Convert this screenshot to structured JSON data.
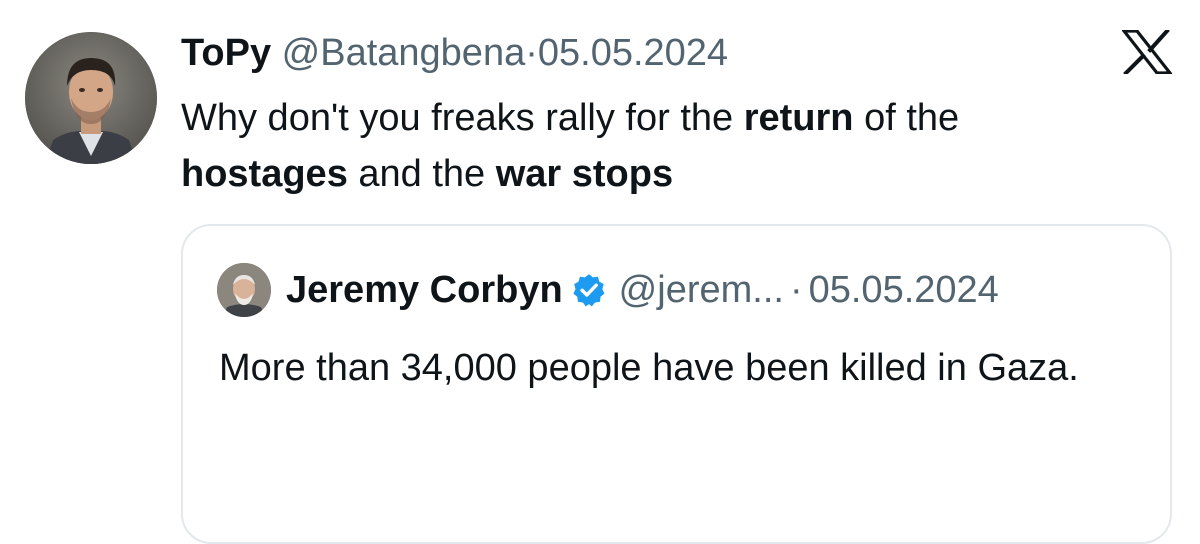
{
  "tweet": {
    "display_name": "ToPy",
    "handle": "@Batangbena",
    "separator": "·",
    "date": "05.05.2024",
    "text_parts": [
      "Why don't you freaks rally for the ",
      "return",
      " of the ",
      "hostages",
      " and the ",
      "war stops"
    ]
  },
  "quoted_tweet": {
    "display_name": "Jeremy Corbyn",
    "handle": "@jerem...",
    "separator": "·",
    "date": "05.05.2024",
    "text": "More than 34,000 people have been killed in Gaza."
  },
  "icons": {
    "platform_logo": "x-logo-icon",
    "verified_badge": "verified-badge-icon"
  },
  "colors": {
    "text": "#0f1419",
    "muted": "#536471",
    "verified": "#1d9bf0",
    "border": "#e4e8eb"
  }
}
